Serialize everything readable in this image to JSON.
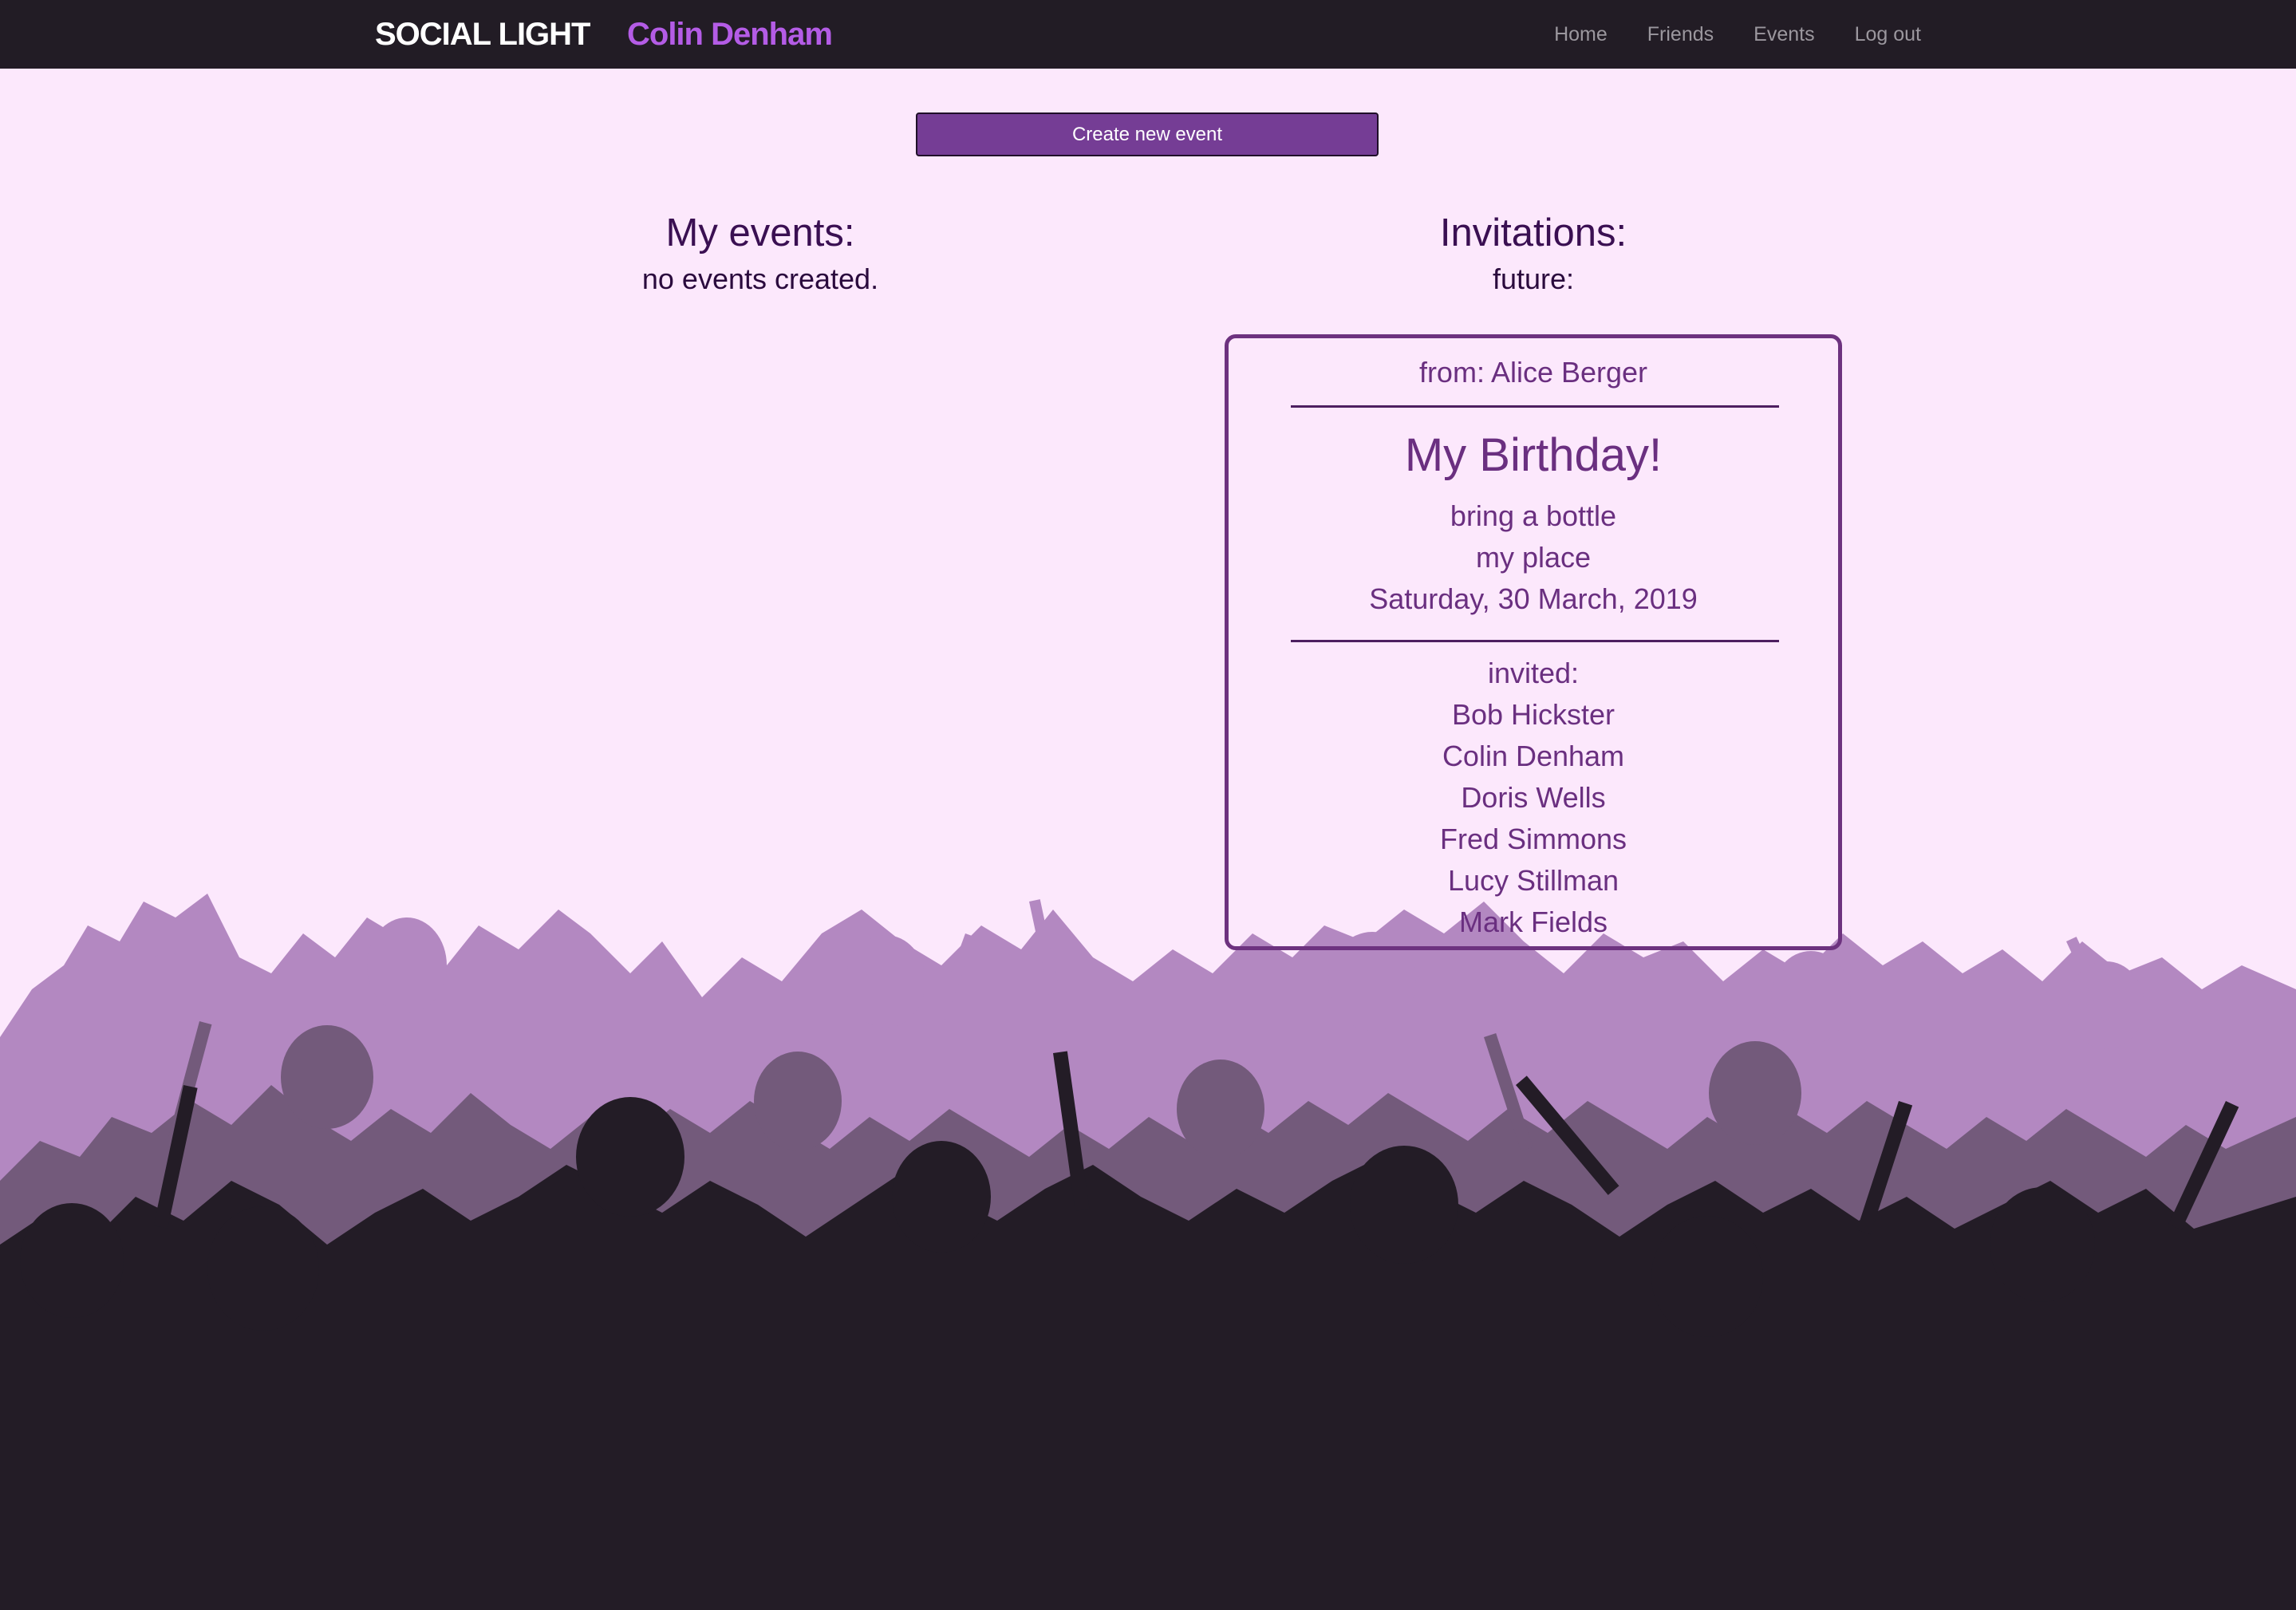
{
  "nav": {
    "brand": "SOCIAL LIGHT",
    "user": "Colin Denham",
    "links": [
      "Home",
      "Friends",
      "Events",
      "Log out"
    ]
  },
  "actions": {
    "create_event": "Create new event"
  },
  "my_events": {
    "heading": "My events:",
    "empty_text": "no events created."
  },
  "invitations": {
    "heading": "Invitations:",
    "section": "future:",
    "cards": [
      {
        "from": "from: Alice Berger",
        "title": "My Birthday!",
        "description": "bring a bottle",
        "location": "my place",
        "date": "Saturday, 30 March, 2019",
        "invited_label": "invited:",
        "invitees": [
          "Bob Hickster",
          "Colin Denham",
          "Doris Wells",
          "Fred Simmons",
          "Lucy Stillman",
          "Mark Fields"
        ]
      }
    ]
  },
  "colors": {
    "page_background": "#fce8fc",
    "navbar": "#221c25",
    "accent": "#753d95",
    "username": "#b45ce6",
    "crowd_back": "#b388c1",
    "crowd_middle": "#735a7b",
    "crowd_front": "#231c26"
  }
}
